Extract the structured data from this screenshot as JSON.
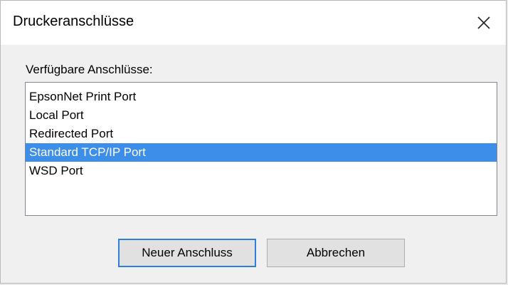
{
  "window": {
    "title": "Druckeranschlüsse",
    "close_icon": "close-icon"
  },
  "ports": {
    "label": "Verfügbare Anschlüsse:",
    "items": [
      "EpsonNet Print Port",
      "Local Port",
      "Redirected Port",
      "Standard TCP/IP Port",
      "WSD Port"
    ],
    "selected_index": 3
  },
  "buttons": {
    "new_port": "Neuer Anschluss",
    "cancel": "Abbrechen"
  },
  "colors": {
    "selection": "#3d8ee8",
    "default_button_border": "#2f7fd8"
  }
}
